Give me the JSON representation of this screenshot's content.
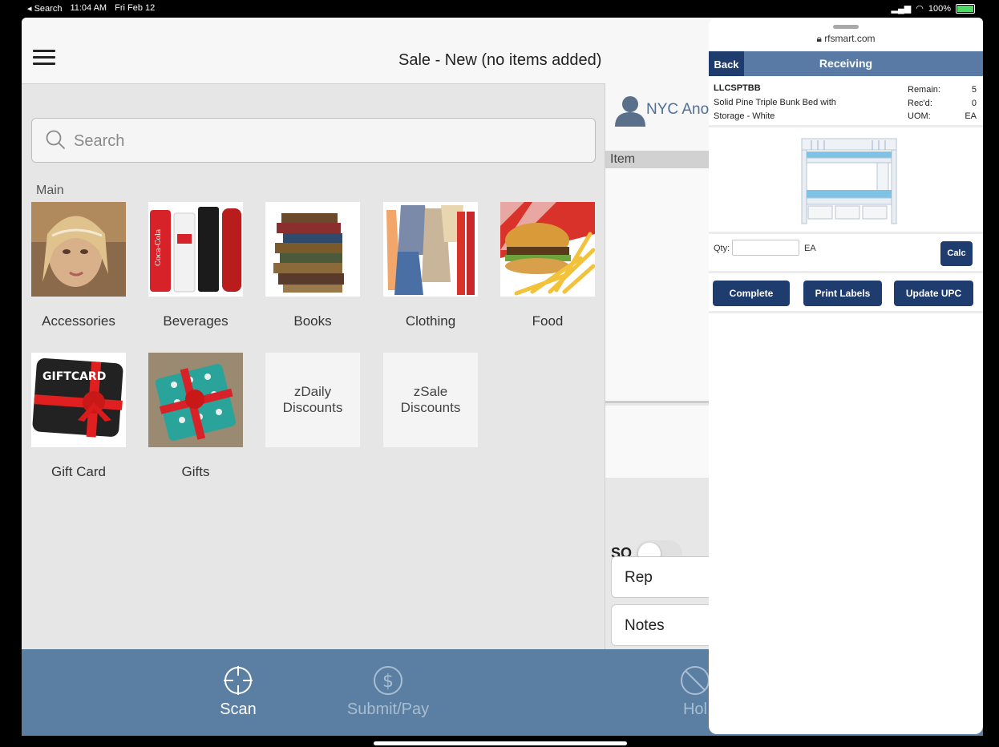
{
  "status_bar": {
    "back_app": "◂ Search",
    "time": "11:04 AM",
    "date": "Fri Feb 12",
    "battery": "100%"
  },
  "header": {
    "title": "Sale - New (no items added)"
  },
  "search": {
    "placeholder": "Search"
  },
  "categories": {
    "section_label": "Main",
    "items": [
      {
        "label": "Accessories"
      },
      {
        "label": "Beverages"
      },
      {
        "label": "Books"
      },
      {
        "label": "Clothing"
      },
      {
        "label": "Food"
      },
      {
        "label": "Gift Card"
      },
      {
        "label": "Gifts"
      },
      {
        "label": "zDaily Discounts"
      },
      {
        "label": "zSale Discounts"
      }
    ],
    "gift_card_text": "GIFTCARD",
    "cola_text": "Coca-Cola"
  },
  "order_panel": {
    "customer": "NYC Ano",
    "item_header": "Item",
    "so_label": "SO",
    "rep_label": "Rep",
    "notes_label": "Notes"
  },
  "bottom_nav": {
    "scan": "Scan",
    "submit_pay": "Submit/Pay",
    "hold": "Hol"
  },
  "receiving": {
    "url": "rfsmart.com",
    "back": "Back",
    "title": "Receiving",
    "sku": "LLCSPTBB",
    "description": "Solid Pine Triple Bunk Bed with Storage - White",
    "remain_label": "Remain:",
    "remain_value": "5",
    "recd_label": "Rec'd:",
    "recd_value": "0",
    "uom_label": "UOM:",
    "uom_value": "EA",
    "qty_label": "Qty:",
    "qty_value": "",
    "qty_unit": "EA",
    "calc": "Calc",
    "complete": "Complete",
    "print_labels": "Print Labels",
    "update_upc": "Update UPC"
  },
  "colors": {
    "nav_bar": "#5a7fa3",
    "button_navy": "#1e3c6e",
    "receiving_bar": "#5a7aa6",
    "customer_text": "#4f6f98"
  }
}
